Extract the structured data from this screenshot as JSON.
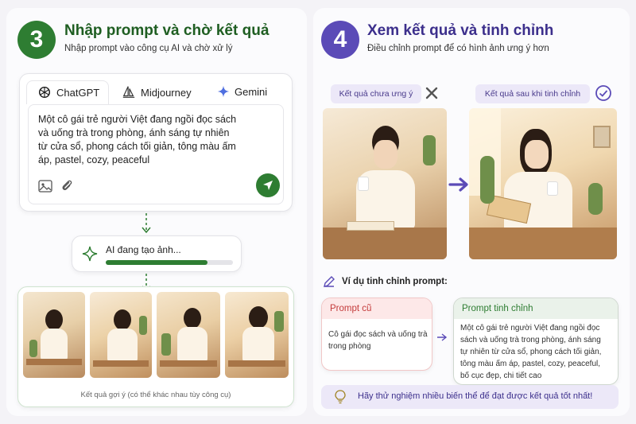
{
  "left": {
    "step_number": "3",
    "title": "Nhập prompt và chờ kết quả",
    "subtitle": "Nhập prompt vào công cụ AI và chờ xử lý",
    "tabs": [
      {
        "label": "ChatGPT",
        "active": true
      },
      {
        "label": "Midjourney",
        "active": false
      },
      {
        "label": "Gemini",
        "active": false
      }
    ],
    "prompt_lines": [
      "Một cô gái trẻ người Việt đang ngồi đọc sách",
      "và uống trà trong phòng, ánh sáng tự nhiên",
      "từ cửa sổ, phong cách tối giản, tông màu ấm",
      "áp, pastel, cozy, peaceful"
    ],
    "progress_label": "AI đang tạo ảnh...",
    "progress": 0.8,
    "results_caption": "Kết quả gợi ý (có thể khác nhau tùy công cụ)"
  },
  "right": {
    "step_number": "4",
    "title": "Xem kết quả và tinh chỉnh",
    "subtitle": "Điều chỉnh prompt để có hình ảnh ưng ý hơn",
    "before_label": "Kết quả chưa ưng ý",
    "after_label": "Kết quả sau khi tinh chỉnh",
    "example_heading": "Ví dụ tinh chỉnh prompt:",
    "old_prompt_title": "Prompt cũ",
    "old_prompt_lines": [
      "Cô gái đọc sách và uống trà",
      "trong phòng"
    ],
    "new_prompt_title": "Prompt tinh chỉnh",
    "new_prompt_lines": [
      "Một cô gái trẻ người Việt đang ngồi đọc",
      "sách và uống trà trong phòng, ánh sáng",
      "tự nhiên từ cửa sổ, phong cách tối giản,",
      "tông màu ấm áp, pastel, cozy, peaceful,",
      "bố cục đẹp, chi tiết cao"
    ],
    "tip": "Hãy thử nghiệm nhiều biến thể để đạt được kết quả tốt nhất!"
  },
  "colors": {
    "green": "#2e7d32",
    "purple": "#5b4bb7",
    "red": "#d64545"
  },
  "icons": [
    "openai-icon",
    "sailboat-icon",
    "sparkle-icon",
    "image-icon",
    "paperclip-icon",
    "send-icon",
    "x-icon",
    "check-circle-icon",
    "arrow-right-icon",
    "pencil-icon",
    "lightbulb-icon"
  ]
}
